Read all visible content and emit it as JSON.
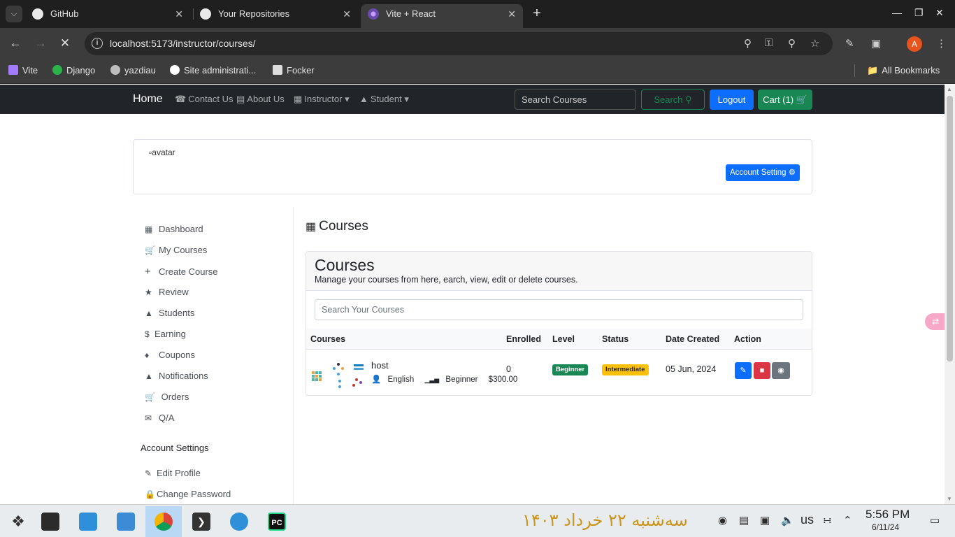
{
  "browser": {
    "tabs": [
      {
        "title": "GitHub",
        "favicon": "github-icon"
      },
      {
        "title": "Your Repositories",
        "favicon": "github-icon"
      },
      {
        "title": "Vite + React",
        "favicon": "react-icon",
        "active": true
      }
    ],
    "url": "localhost:5173/instructor/courses/",
    "bookmarks": [
      "Vite",
      "Django",
      "yazdiau",
      "Site administrati...",
      "Focker"
    ],
    "all_bookmarks": "All Bookmarks",
    "profile_initial": "A"
  },
  "navbar": {
    "brand": "Home",
    "links": [
      "Contact Us",
      "About Us",
      "Instructor",
      "Student"
    ],
    "search_placeholder": "Search Courses",
    "search_button": "Search",
    "logout_button": "Logout",
    "cart_button": "Cart (1)"
  },
  "profile": {
    "avatar_alt": "avatar",
    "account_setting_button": "Account Setting"
  },
  "sidebar": {
    "items": [
      "Dashboard",
      "My Courses",
      "Create Course",
      "Review",
      "Students",
      "Earning",
      "Coupons",
      "Notifications",
      "Orders",
      "Q/A"
    ],
    "account_heading": "Account Settings",
    "account_items": [
      "Edit Profile",
      "Change Password"
    ]
  },
  "main": {
    "page_title": "Courses",
    "card_title": "Courses",
    "card_subtitle": "Manage your courses from here, earch, view, edit or delete courses.",
    "search_placeholder": "Search Your Courses",
    "columns": [
      "Courses",
      "Enrolled",
      "Level",
      "Status",
      "Date Created",
      "Action"
    ],
    "rows": [
      {
        "name": "host",
        "language": "English",
        "level_meta": "Beginner",
        "price": "$300.00",
        "enrolled": "0",
        "level_badge": "Beginner",
        "status_badge": "Intermediate",
        "date_created": "05 Jun, 2024"
      }
    ]
  },
  "taskbar": {
    "persian_date": "سه‌شنبه ۲۲ خرداد ۱۴۰۳",
    "keyboard_layout": "us",
    "time": "5:56 PM",
    "date": "6/11/24"
  },
  "colors": {
    "primary": "#0d6efd",
    "success": "#198754",
    "warning": "#ffc107",
    "danger": "#dc3545",
    "secondary": "#6c757d",
    "navbar_bg": "#212529"
  }
}
